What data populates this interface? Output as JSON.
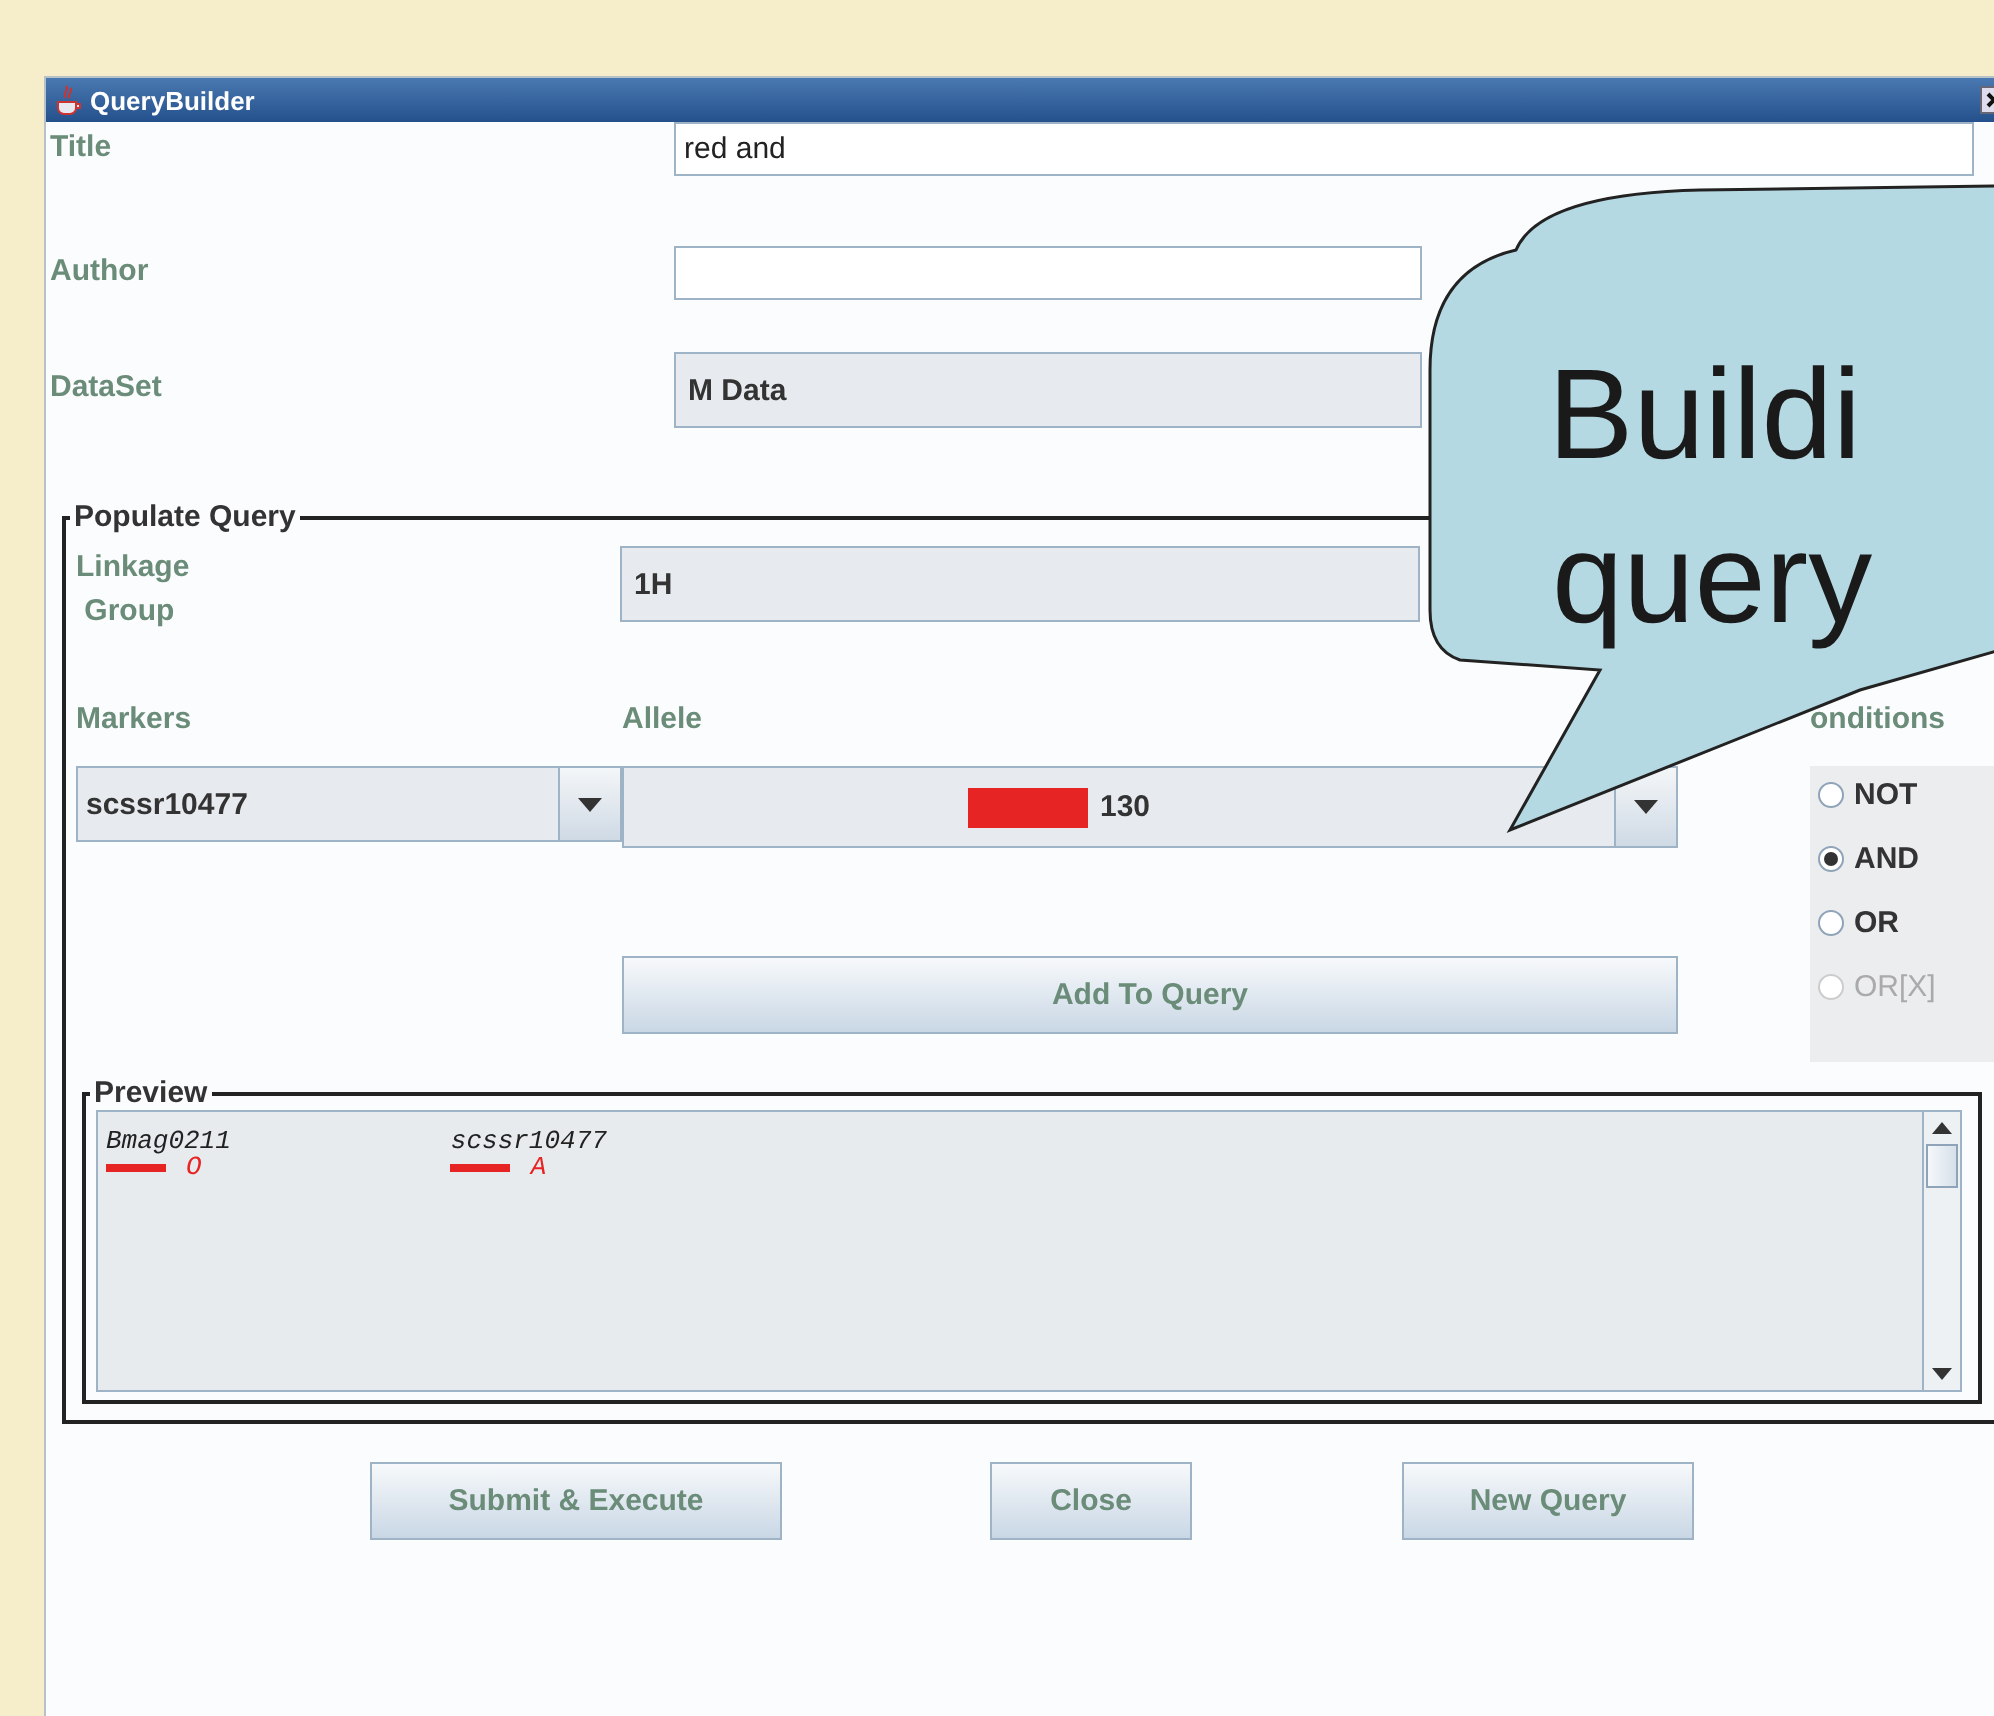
{
  "window": {
    "title": "QueryBuilder"
  },
  "form": {
    "title_label": "Title",
    "title_value": "red and",
    "author_label": "Author",
    "dataset_label": "DataSet",
    "dataset_value": "M Data"
  },
  "populate": {
    "legend": "Populate Query",
    "linkage_label_line1": "Linkage",
    "linkage_label_line2": "Group",
    "linkage_value": "1H",
    "markers_label": "Markers",
    "allele_label": "Allele",
    "conditions_label": "onditions",
    "marker_value": "scssr10477",
    "allele_value": "130",
    "add_button": "Add To Query",
    "conditions": [
      {
        "label": "NOT",
        "selected": false,
        "disabled": false
      },
      {
        "label": "AND",
        "selected": true,
        "disabled": false
      },
      {
        "label": "OR",
        "selected": false,
        "disabled": false
      },
      {
        "label": "OR[X]",
        "selected": false,
        "disabled": true
      }
    ]
  },
  "preview": {
    "legend": "Preview",
    "entries": [
      {
        "marker": "Bmag0211",
        "allele": "O"
      },
      {
        "marker": "scssr10477",
        "allele": "A"
      }
    ]
  },
  "buttons": [
    "Submit & Execute",
    "Close",
    "New Query"
  ],
  "callout": {
    "line1": "Buildi",
    "line2": "query"
  }
}
